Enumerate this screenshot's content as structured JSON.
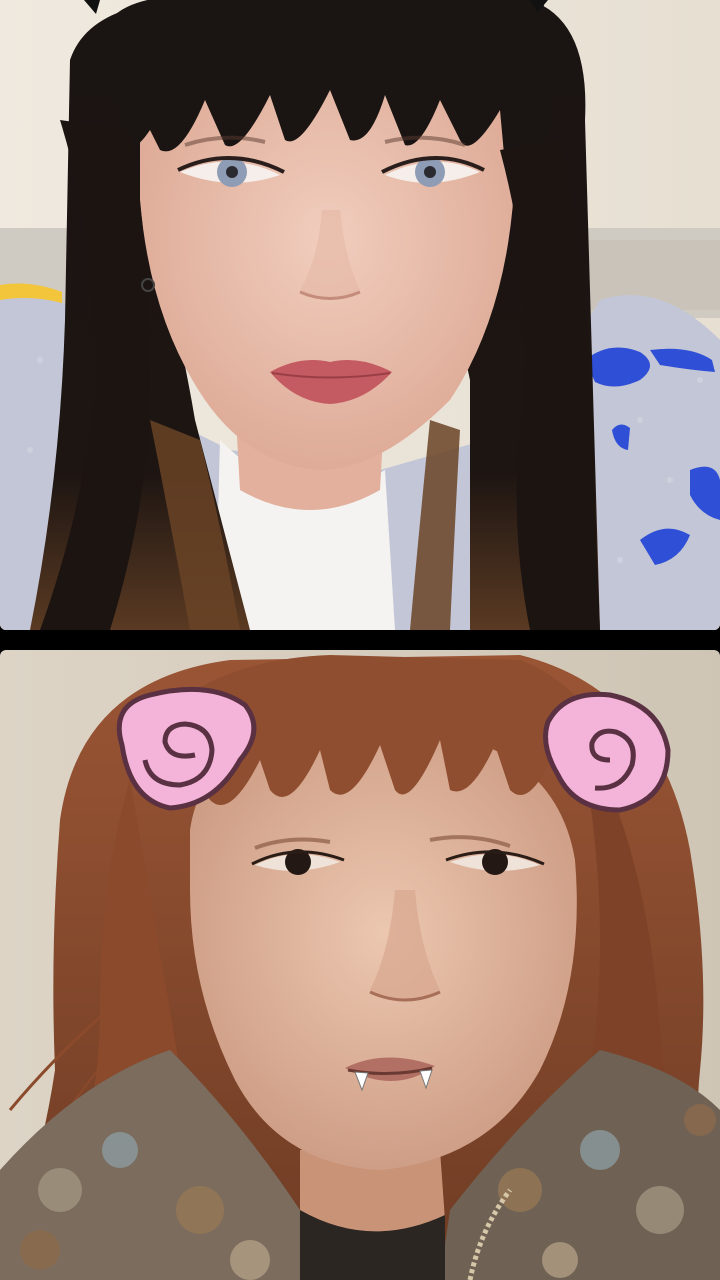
{
  "live_session": {
    "layout": "split-screen",
    "participants": [
      {
        "position": "top",
        "video_feed": "host-camera",
        "effect_overlays": [
          "cat-ear-tips"
        ]
      },
      {
        "position": "bottom",
        "video_feed": "guest-camera",
        "effect_overlays": [
          "pink-spiral-ears",
          "vampire-fangs"
        ]
      }
    ]
  },
  "colors": {
    "divider": "#000000",
    "top_wall": "#ece6da",
    "top_sweater": "#c3c6d6",
    "top_sweater_pattern": "#2f4fd6",
    "top_hair": "#16110f",
    "top_skin": "#ecc4b3",
    "top_lips": "#c45b62",
    "bottom_wall": "#d8cfc0",
    "bottom_hair": "#8a4e30",
    "bottom_skin": "#e3bba3",
    "bottom_coat": "#7b6c5e",
    "ear_fill": "#f4b3d9",
    "ear_outline": "#5a3142"
  }
}
